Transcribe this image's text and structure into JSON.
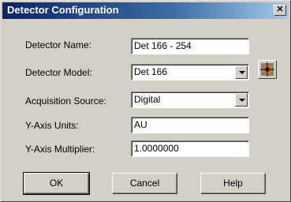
{
  "window": {
    "title": "Detector Configuration",
    "close_glyph": "✕"
  },
  "form": {
    "detector_name_label": "Detector Name:",
    "detector_name_value": "Det 166 - 254",
    "detector_model_label": "Detector Model:",
    "detector_model_value": "Det 166",
    "acquisition_source_label": "Acquisition Source:",
    "acquisition_source_value": "Digital",
    "y_axis_units_label": "Y-Axis Units:",
    "y_axis_units_value": "AU",
    "y_axis_multiplier_label": "Y-Axis Multiplier:",
    "y_axis_multiplier_value": "1.0000000"
  },
  "buttons": {
    "ok": "OK",
    "cancel": "Cancel",
    "help": "Help"
  },
  "icons": {
    "model_config": "detector-settings-icon",
    "dropdown": "chevron-down-icon"
  }
}
